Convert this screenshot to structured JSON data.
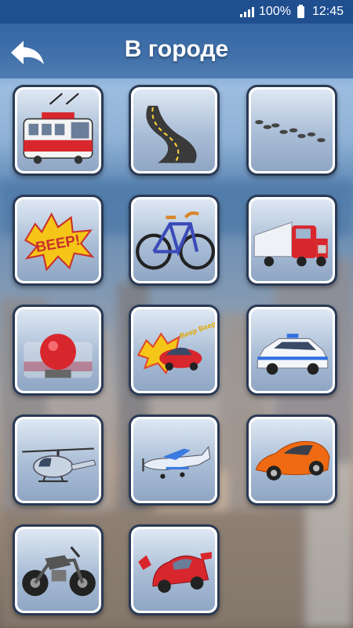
{
  "status_bar": {
    "battery_percent": "100%",
    "time": "12:45"
  },
  "header": {
    "title": "В городе",
    "back_icon": "back-arrow-icon"
  },
  "tiles": [
    {
      "id": "tram",
      "icon": "tram-icon",
      "beep_text": ""
    },
    {
      "id": "road",
      "icon": "road-icon",
      "beep_text": ""
    },
    {
      "id": "footsteps",
      "icon": "footsteps-icon",
      "beep_text": ""
    },
    {
      "id": "beep",
      "icon": "beep-icon",
      "beep_text": "BEEP!"
    },
    {
      "id": "bicycle",
      "icon": "bicycle-icon",
      "beep_text": ""
    },
    {
      "id": "truck",
      "icon": "truck-icon",
      "beep_text": ""
    },
    {
      "id": "tram-bell",
      "icon": "tram-bell-icon",
      "beep_text": ""
    },
    {
      "id": "car-horn",
      "icon": "car-horn-icon",
      "beep_text": "Beep Beep"
    },
    {
      "id": "police-car",
      "icon": "police-car-icon",
      "beep_text": ""
    },
    {
      "id": "helicopter",
      "icon": "helicopter-icon",
      "beep_text": ""
    },
    {
      "id": "airplane",
      "icon": "airplane-icon",
      "beep_text": ""
    },
    {
      "id": "sports-car",
      "icon": "sports-car-icon",
      "beep_text": ""
    },
    {
      "id": "motorcycle",
      "icon": "motorcycle-icon",
      "beep_text": ""
    },
    {
      "id": "race-car",
      "icon": "race-car-icon",
      "beep_text": ""
    }
  ]
}
